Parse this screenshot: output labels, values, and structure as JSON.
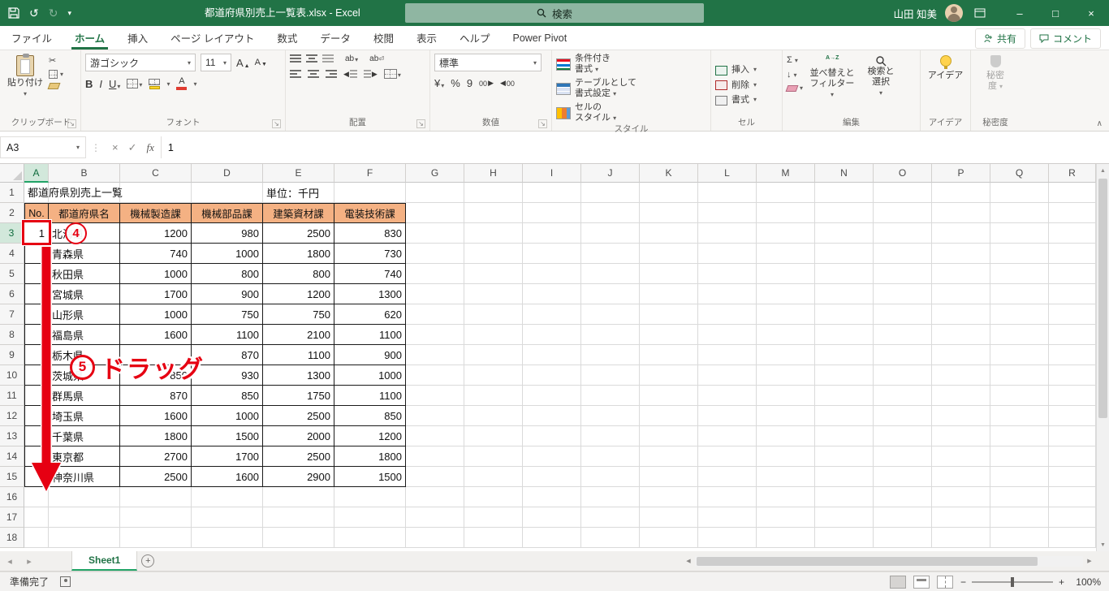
{
  "title_bar": {
    "document_title": "都道府県別売上一覧表.xlsx  -  Excel",
    "search_placeholder": "検索",
    "user_name": "山田 知美"
  },
  "ribbon_tabs": {
    "items": [
      "ファイル",
      "ホーム",
      "挿入",
      "ページ レイアウト",
      "数式",
      "データ",
      "校閲",
      "表示",
      "ヘルプ",
      "Power Pivot"
    ],
    "active": "ホーム",
    "share": "共有",
    "comments": "コメント"
  },
  "ribbon": {
    "clipboard": {
      "label": "クリップボード",
      "paste": "貼り付け"
    },
    "font": {
      "label": "フォント",
      "name": "游ゴシック",
      "size": "11"
    },
    "alignment": {
      "label": "配置"
    },
    "number": {
      "label": "数値",
      "format": "標準"
    },
    "styles": {
      "label": "スタイル",
      "conditional_l1": "条件付き",
      "conditional_l2": "書式",
      "table_l1": "テーブルとして",
      "table_l2": "書式設定",
      "cell_l1": "セルの",
      "cell_l2": "スタイル"
    },
    "cells": {
      "label": "セル",
      "insert": "挿入",
      "delete": "削除",
      "format": "書式"
    },
    "editing": {
      "label": "編集",
      "sort_l1": "並べ替えと",
      "sort_l2": "フィルター",
      "find_l1": "検索と",
      "find_l2": "選択"
    },
    "ideas": {
      "label": "アイデア",
      "button": "アイデア"
    },
    "sensitivity": {
      "label": "秘密度",
      "l1": "秘密",
      "l2": "度"
    }
  },
  "formula_bar": {
    "name_box": "A3",
    "value": "1"
  },
  "sheet": {
    "column_letters": [
      "A",
      "B",
      "C",
      "D",
      "E",
      "F",
      "G",
      "H",
      "I",
      "J",
      "K",
      "L",
      "M",
      "N",
      "O",
      "P",
      "Q",
      "R"
    ],
    "row_count": 18,
    "active_cell": "A3",
    "cells_title": "都道府県別売上一覧",
    "cells_unit": "単位：千円",
    "table": {
      "headers": [
        "No.",
        "都道府県名",
        "機械製造課",
        "機械部品課",
        "建築資材課",
        "電装技術課"
      ],
      "rows": [
        {
          "no": "1",
          "pref": "北海道",
          "values": [
            "1200",
            "980",
            "2500",
            "830"
          ]
        },
        {
          "no": "",
          "pref": "青森県",
          "values": [
            "740",
            "1000",
            "1800",
            "730"
          ]
        },
        {
          "no": "",
          "pref": "秋田県",
          "values": [
            "1000",
            "800",
            "800",
            "740"
          ]
        },
        {
          "no": "",
          "pref": "宮城県",
          "values": [
            "1700",
            "900",
            "1200",
            "1300"
          ]
        },
        {
          "no": "",
          "pref": "山形県",
          "values": [
            "1000",
            "750",
            "750",
            "620"
          ]
        },
        {
          "no": "",
          "pref": "福島県",
          "values": [
            "1600",
            "1100",
            "2100",
            "1100"
          ]
        },
        {
          "no": "",
          "pref": "栃木県",
          "values": [
            "",
            "870",
            "1100",
            "900"
          ]
        },
        {
          "no": "",
          "pref": "茨城県",
          "values": [
            "850",
            "930",
            "1300",
            "1000"
          ]
        },
        {
          "no": "",
          "pref": "群馬県",
          "values": [
            "870",
            "850",
            "1750",
            "1100"
          ]
        },
        {
          "no": "",
          "pref": "埼玉県",
          "values": [
            "1600",
            "1000",
            "2500",
            "850"
          ]
        },
        {
          "no": "",
          "pref": "千葉県",
          "values": [
            "1800",
            "1500",
            "2000",
            "1200"
          ]
        },
        {
          "no": "",
          "pref": "東京都",
          "values": [
            "2700",
            "1700",
            "2500",
            "1800"
          ]
        },
        {
          "no": "",
          "pref": "神奈川県",
          "values": [
            "2500",
            "1600",
            "2900",
            "1500"
          ]
        }
      ]
    }
  },
  "annotations": {
    "step4_number": "4",
    "step5_number": "5",
    "step5_label": "ドラッグ"
  },
  "sheet_tabs": {
    "active_sheet": "Sheet1"
  },
  "status_bar": {
    "status": "準備完了",
    "zoom_level": "100%"
  },
  "icons": {
    "dropdown": "▾",
    "launcher": "↘",
    "collapse": "∧",
    "ellipsis_v": "⋮",
    "undo": "↺",
    "redo": "↻",
    "cut": "✂",
    "up": "▲",
    "down": "▼",
    "left": "◀",
    "right": "▶",
    "sheet_nav_left": "◂",
    "sheet_nav_right": "▸",
    "plus": "+",
    "minus": "−",
    "x": "×",
    "check": "✓",
    "fx": "fx",
    "bold": "B",
    "italic": "I",
    "underline": "U",
    "letter_a": "A",
    "sigma": "Σ",
    "fill_down": "↓",
    "currency": "¥",
    "percent": "%",
    "comma_style": "9",
    "zeros": "00",
    "minimize": "–",
    "maximize": "□",
    "close": "×",
    "sort_az": "A→Z"
  }
}
